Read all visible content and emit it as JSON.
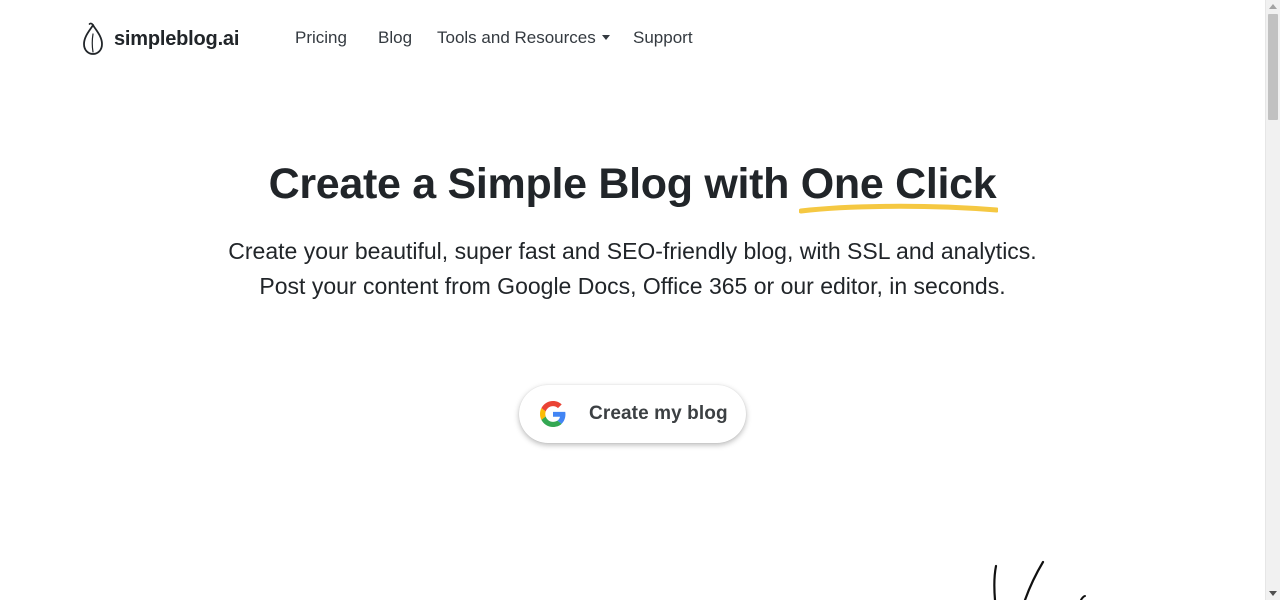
{
  "brand": {
    "name": "simpleblog.ai",
    "logo_icon": "leaf-drop-icon"
  },
  "nav": {
    "pricing": "Pricing",
    "blog": "Blog",
    "tools": "Tools and Resources",
    "support": "Support"
  },
  "hero": {
    "title_prefix": "Create a Simple Blog with ",
    "title_highlight": "One Click",
    "highlight_color": "#f5c842",
    "subtitle_line1": "Create your beautiful, super fast and SEO-friendly blog, with SSL and analytics.",
    "subtitle_line2": "Post your content from Google Docs, Office 365 or our editor, in seconds."
  },
  "cta": {
    "label": "Create my blog",
    "icon": "google-g-icon"
  },
  "colors": {
    "text": "#212529",
    "nav_text": "#343a40",
    "background": "#ffffff"
  }
}
